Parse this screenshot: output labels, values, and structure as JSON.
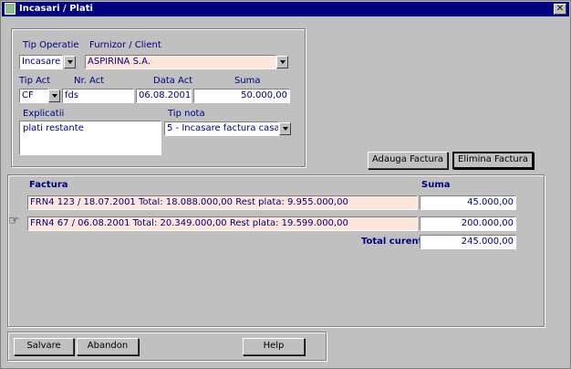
{
  "window": {
    "title": "Incasari / Plati",
    "close_glyph": "✕"
  },
  "form": {
    "tip_operatie": {
      "label": "Tip Operatie",
      "value": "Incasare"
    },
    "furnizor": {
      "label": "Furnizor / Client",
      "value": "ASPIRINA S.A."
    },
    "tip_act": {
      "label": "Tip Act",
      "value": "CF"
    },
    "nr_act": {
      "label": "Nr. Act",
      "value": "fds"
    },
    "data_act": {
      "label": "Data Act",
      "value": "06.08.2001"
    },
    "suma": {
      "label": "Suma",
      "value": "50.000,00"
    },
    "explicatii": {
      "label": "Explicatii",
      "value": "plati restante"
    },
    "tip_nota": {
      "label": "Tip nota",
      "value": "5 - Incasare factura casa"
    }
  },
  "actions": {
    "add": "Adauga Factura",
    "remove": "Elimina Factura"
  },
  "invoices": {
    "col_factura": "Factura",
    "col_suma": "Suma",
    "rows": [
      {
        "factura": "FRN4 123 / 18.07.2001   Total: 18.088.000,00   Rest plata: 9.955.000,00",
        "suma": "45.000,00"
      },
      {
        "factura": "FRN4 67 / 06.08.2001   Total: 20.349.000,00   Rest plata: 19.599.000,00",
        "suma": "200.000,00"
      }
    ],
    "total_label": "Total curent",
    "total_value": "245.000,00",
    "pointer_glyph": "☞"
  },
  "footer": {
    "save": "Salvare",
    "abandon": "Abandon",
    "help": "Help"
  }
}
